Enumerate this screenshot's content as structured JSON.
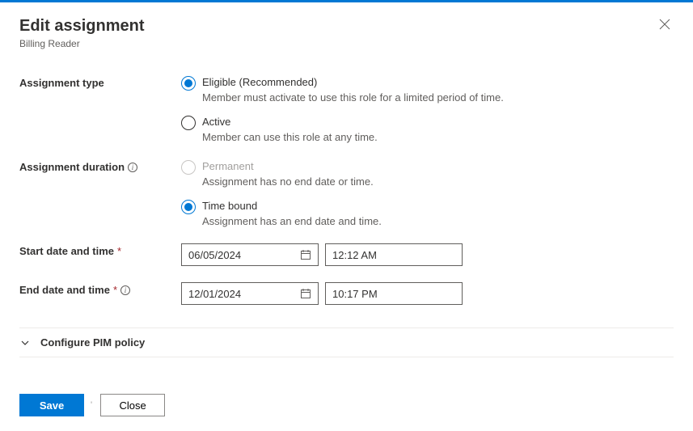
{
  "header": {
    "title": "Edit assignment",
    "subtitle": "Billing Reader"
  },
  "assignment_type": {
    "label": "Assignment type",
    "eligible": {
      "label": "Eligible (Recommended)",
      "desc": "Member must activate to use this role for a limited period of time."
    },
    "active": {
      "label": "Active",
      "desc": "Member can use this role at any time."
    }
  },
  "assignment_duration": {
    "label": "Assignment duration",
    "permanent": {
      "label": "Permanent",
      "desc": "Assignment has no end date or time."
    },
    "timebound": {
      "label": "Time bound",
      "desc": "Assignment has an end date and time."
    }
  },
  "start": {
    "label": "Start date and time",
    "date": "06/05/2024",
    "time": "12:12 AM"
  },
  "end": {
    "label": "End date and time",
    "date": "12/01/2024",
    "time": "10:17 PM"
  },
  "expander": {
    "label": "Configure PIM policy"
  },
  "footer": {
    "save": "Save",
    "close": "Close"
  }
}
